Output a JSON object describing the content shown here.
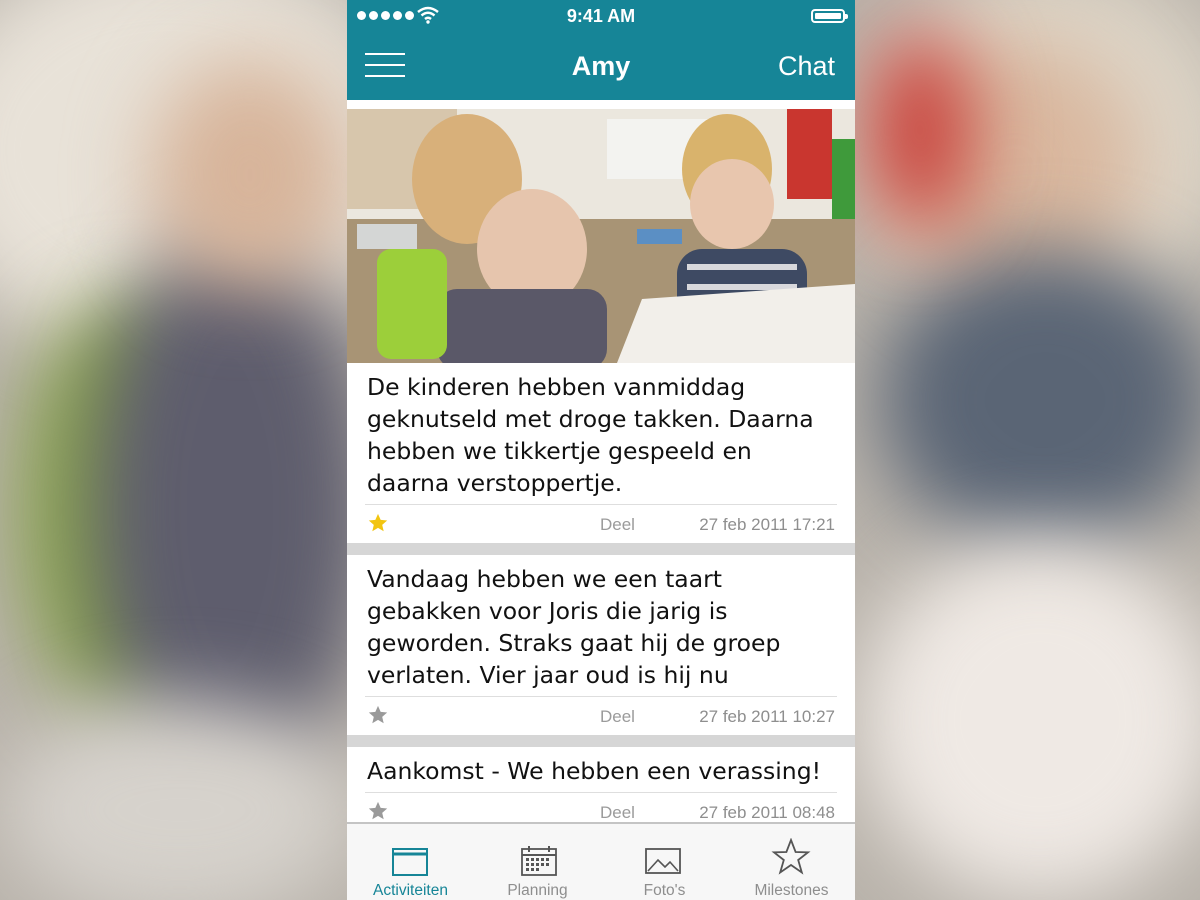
{
  "status_bar": {
    "time": "9:41 AM",
    "icons": [
      "signal-dots-icon",
      "wifi-icon",
      "battery-icon"
    ]
  },
  "nav": {
    "title": "Amy",
    "chat_label": "Chat",
    "menu_icon": "hamburger-icon"
  },
  "feed": {
    "items": [
      {
        "has_photo": true,
        "text": "De kinderen hebben vanmiddag geknutseld met droge takken. Daarna hebben we tikkertje gespeeld en daarna verstoppertje.",
        "starred": true,
        "share_label": "Deel",
        "timestamp": "27 feb 2011  17:21"
      },
      {
        "has_photo": false,
        "text": "Vandaag hebben we een taart gebakken voor Joris die jarig is geworden. Straks gaat hij de groep verlaten. Vier jaar oud is hij nu",
        "starred": false,
        "share_label": "Deel",
        "timestamp": "27 feb 2011  10:27"
      },
      {
        "has_photo": false,
        "text": "Aankomst - We hebben een verassing!",
        "starred": false,
        "share_label": "Deel",
        "timestamp": "27 feb 2011  08:48"
      }
    ]
  },
  "tabs": [
    {
      "label": "Activiteiten",
      "icon": "activity-icon",
      "active": true
    },
    {
      "label": "Planning",
      "icon": "calendar-icon",
      "active": false
    },
    {
      "label": "Foto's",
      "icon": "photo-icon",
      "active": false
    },
    {
      "label": "Milestones",
      "icon": "star-icon",
      "active": false
    }
  ],
  "colors": {
    "brand": "#168597",
    "star_active": "#f2c511",
    "star_inactive": "#9a9a9a",
    "tab_inactive": "#8e8e8e"
  }
}
